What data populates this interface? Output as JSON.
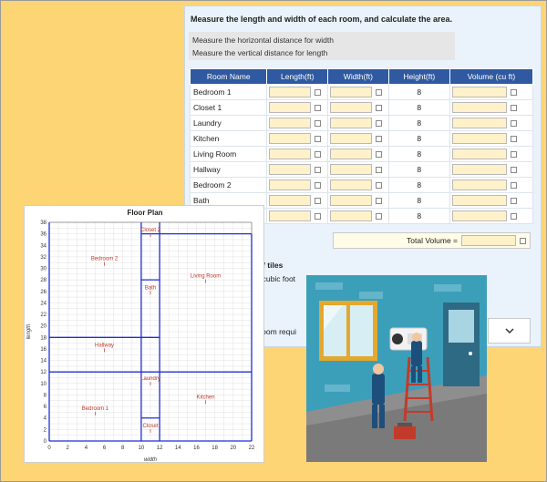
{
  "worksheet": {
    "instruction": "Measure the length and width of each room, and calculate the area.",
    "hints": [
      "Measure the horizontal distance for width",
      "Measure the vertical distance for length"
    ],
    "columns": [
      "Room Name",
      "Length(ft)",
      "Width(ft)",
      "Height(ft)",
      "Volume (cu ft)"
    ],
    "rooms": [
      {
        "name": "Bedroom 1",
        "height": "8"
      },
      {
        "name": "Closet 1",
        "height": "8"
      },
      {
        "name": "Laundry",
        "height": "8"
      },
      {
        "name": "Kitchen",
        "height": "8"
      },
      {
        "name": "Living Room",
        "height": "8"
      },
      {
        "name": "Hallway",
        "height": "8"
      },
      {
        "name": "Bedroom 2",
        "height": "8"
      },
      {
        "name": "Bath",
        "height": "8"
      },
      {
        "name": "",
        "height": "8"
      }
    ],
    "total_label": "Total Volume =",
    "tiles_title": "st of tiles",
    "tiles_text": "per cubic foot",
    "requirement_text": "ch room requi",
    "dropdown_icon": "chevron-down-icon"
  },
  "floor_plan": {
    "title": "Floor Plan",
    "xlabel": "width",
    "ylabel": "length",
    "x_ticks": [
      "0",
      "2",
      "4",
      "6",
      "8",
      "10",
      "12",
      "14",
      "16",
      "18",
      "20",
      "22"
    ],
    "y_ticks": [
      "0",
      "2",
      "4",
      "6",
      "8",
      "10",
      "12",
      "14",
      "16",
      "18",
      "20",
      "22",
      "24",
      "26",
      "28",
      "30",
      "32",
      "34",
      "36",
      "38"
    ],
    "room_labels": [
      "Closet 2",
      "Bedroom 2",
      "Living Room",
      "Bath",
      "Hallway",
      "Laundry",
      "Kitchen",
      "Bedroom 1",
      "Closet"
    ],
    "colors": {
      "walls": "#1f2fd6",
      "labels": "#c0392b"
    }
  },
  "illustration": {
    "subject": "two technicians installing an air conditioner unit on a wall"
  }
}
